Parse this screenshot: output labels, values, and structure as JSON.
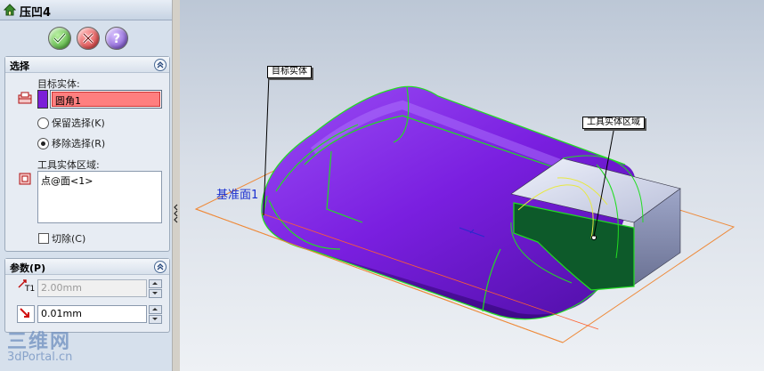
{
  "feature": {
    "title": "压凹4"
  },
  "actions": {
    "ok_icon": "checkmark-icon",
    "cancel_icon": "x-icon",
    "help_icon": "question-icon"
  },
  "selection": {
    "header": "选择",
    "target_label": "目标实体:",
    "target_value": "圆角1",
    "target_highlight": "#ff7f7f",
    "target_swatch": "#7b1fd8",
    "keep_selection": "保留选择(K)",
    "remove_selection": "移除选择(R)",
    "remove_selected": true,
    "tool_region_label": "工具实体区域:",
    "tool_region_items": [
      "点@面<1>"
    ],
    "cut_label": "切除(C)",
    "cut_checked": false
  },
  "parameters": {
    "header": "参数(P)",
    "thickness_value": "2.00mm",
    "thickness_symbol": "T1",
    "clearance_value": "0.01mm"
  },
  "viewport": {
    "callout_target": "目标实体",
    "callout_tool": "工具实体区域",
    "plane_label": "基准面1",
    "body_color": "#7a1fe0",
    "edge_color": "#22dd22"
  },
  "watermark": {
    "line1": "三维网",
    "line2": "3dPortal.cn"
  }
}
